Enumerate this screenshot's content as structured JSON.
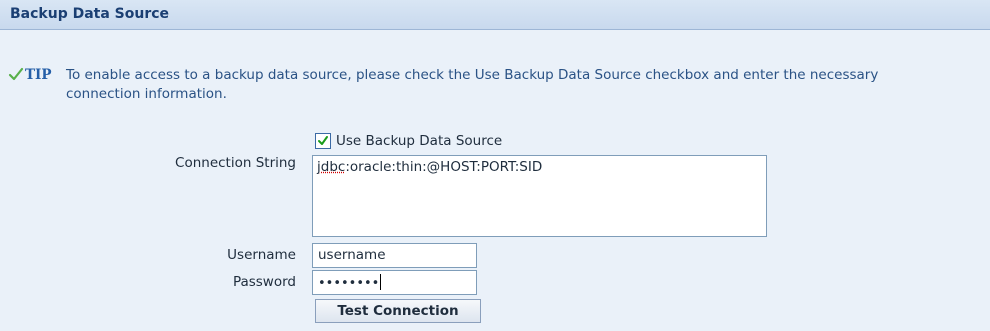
{
  "section": {
    "title": "Backup Data Source"
  },
  "tip": {
    "label": "TIP",
    "text": "To enable access to a backup data source, please check the Use Backup Data Source checkbox and enter the necessary connection information."
  },
  "form": {
    "use_backup": {
      "label": "Use Backup Data Source",
      "checked": true
    },
    "connection_string": {
      "label": "Connection String",
      "value_prefix": "jdbc",
      "value_rest": ":oracle:thin:@HOST:PORT:SID"
    },
    "username": {
      "label": "Username",
      "value": "username"
    },
    "password": {
      "label": "Password",
      "masked_value": "••••••••"
    },
    "test_button_label": "Test Connection"
  },
  "colors": {
    "panel_bg": "#eaf1f9",
    "header_bg": "#c8d9ee",
    "title_color": "#1b3f73",
    "tip_color": "#2a5285"
  },
  "icons": {
    "tip": "checkmark-icon",
    "checkbox": "checkbox-checked-icon"
  }
}
